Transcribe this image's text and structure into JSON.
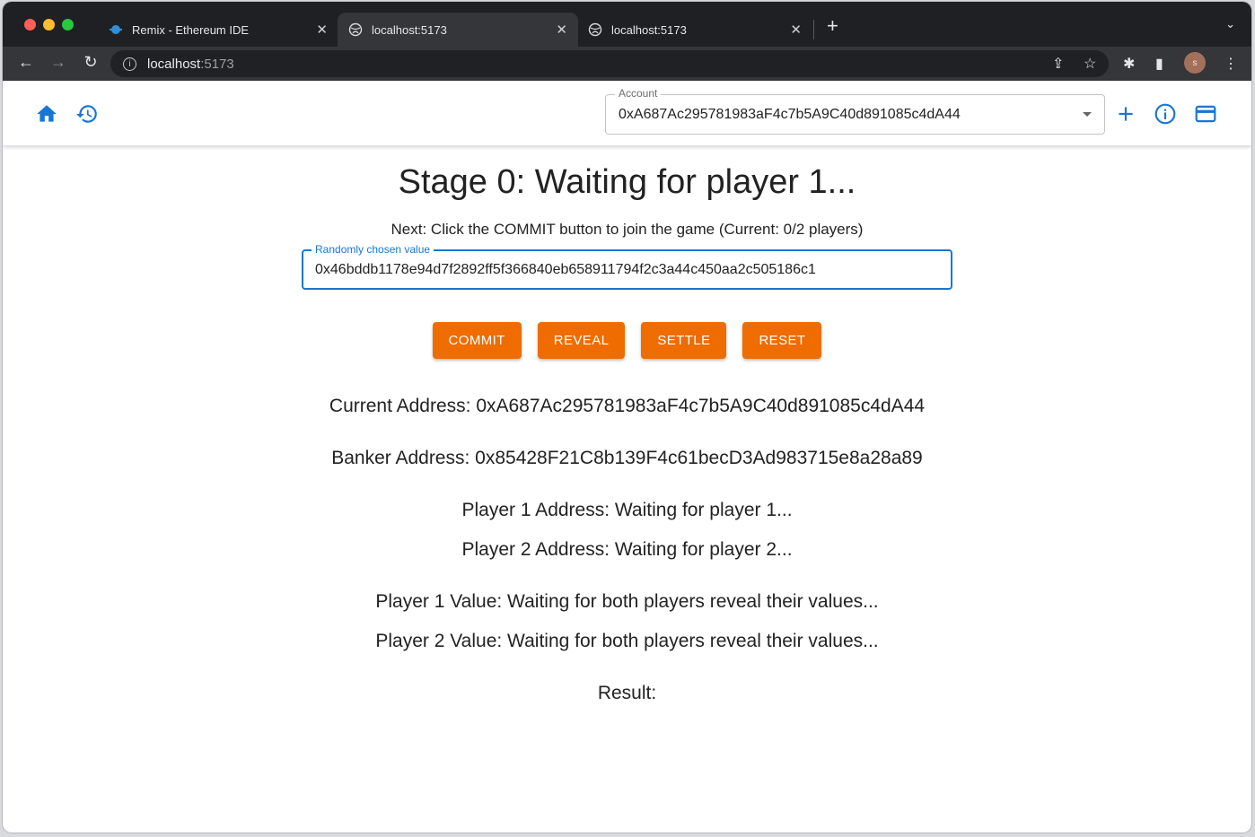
{
  "browser": {
    "tabs": [
      {
        "title": "Remix - Ethereum IDE",
        "active": false
      },
      {
        "title": "localhost:5173",
        "active": true
      },
      {
        "title": "localhost:5173",
        "active": false
      }
    ],
    "url_host": "localhost",
    "url_port": ":5173",
    "profile_initial": "s"
  },
  "appbar": {
    "account_label": "Account",
    "account_value": "0xA687Ac295781983aF4c7b5A9C40d891085c4dA44"
  },
  "main": {
    "stage_title": "Stage 0: Waiting for player 1...",
    "next_text": "Next: Click the COMMIT button to join the game (Current: 0/2 players)",
    "random_label": "Randomly chosen value",
    "random_value": "0x46bddb1178e94d7f2892ff5f366840eb658911794f2c3a44c450aa2c505186c1",
    "buttons": [
      "COMMIT",
      "REVEAL",
      "SETTLE",
      "RESET"
    ],
    "current_address": "Current Address: 0xA687Ac295781983aF4c7b5A9C40d891085c4dA44",
    "banker_address": "Banker Address: 0x85428F21C8b139F4c61becD3Ad983715e8a28a89",
    "player1_address": "Player 1 Address: Waiting for player 1...",
    "player2_address": "Player 2 Address: Waiting for player 2...",
    "player1_value": "Player 1 Value: Waiting for both players reveal their values...",
    "player2_value": "Player 2 Value: Waiting for both players reveal their values...",
    "result": "Result:"
  },
  "colors": {
    "accent": "#1976d2",
    "button": "#ef6c00"
  }
}
